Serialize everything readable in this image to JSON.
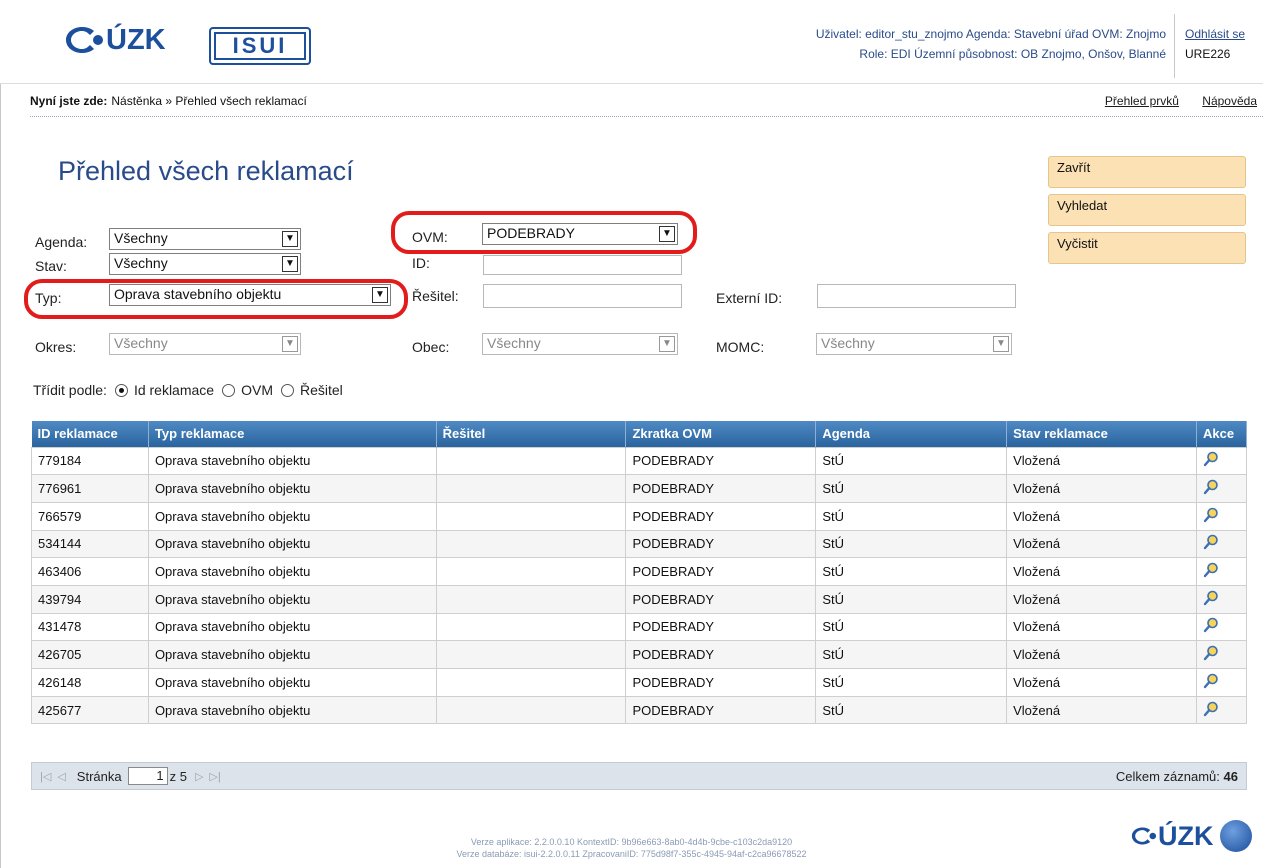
{
  "header": {
    "logo_text": "ÚZK",
    "isui_label": "ISUI",
    "user_line1": "Uživatel: editor_stu_znojmo   Agenda: Stavební úřad   OVM: Znojmo",
    "user_line2": "Role: EDI   Územní působnost: OB Znojmo, Onšov, Blanné",
    "logout_label": "Odhlásit se",
    "code": "URE226"
  },
  "breadcrumb": {
    "prefix": "Nyní jste zde:",
    "path": "Nástěnka » Přehled všech reklamací",
    "link_overview": "Přehled prvků",
    "link_help": "Nápověda"
  },
  "page": {
    "title": "Přehled všech reklamací"
  },
  "actions": {
    "close": "Zavřít",
    "search": "Vyhledat",
    "clear": "Vyčistit"
  },
  "filters": {
    "agenda_label": "Agenda:",
    "agenda_value": "Všechny",
    "stav_label": "Stav:",
    "stav_value": "Všechny",
    "typ_label": "Typ:",
    "typ_value": "Oprava stavebního objektu",
    "okres_label": "Okres:",
    "okres_value": "Všechny",
    "ovm_label": "OVM:",
    "ovm_value": "PODEBRADY",
    "id_label": "ID:",
    "resitel_label": "Řešitel:",
    "obec_label": "Obec:",
    "obec_value": "Všechny",
    "externi_label": "Externí ID:",
    "momc_label": "MOMC:",
    "momc_value": "Všechny"
  },
  "sort": {
    "label": "Třídit podle:",
    "options": [
      "Id reklamace",
      "OVM",
      "Řešitel"
    ],
    "selected": "Id reklamace"
  },
  "table": {
    "columns": [
      "ID reklamace",
      "Typ reklamace",
      "Řešitel",
      "Zkratka OVM",
      "Agenda",
      "Stav reklamace",
      "Akce"
    ],
    "rows": [
      [
        "779184",
        "Oprava stavebního objektu",
        "",
        "PODEBRADY",
        "StÚ",
        "Vložená"
      ],
      [
        "776961",
        "Oprava stavebního objektu",
        "",
        "PODEBRADY",
        "StÚ",
        "Vložená"
      ],
      [
        "766579",
        "Oprava stavebního objektu",
        "",
        "PODEBRADY",
        "StÚ",
        "Vložená"
      ],
      [
        "534144",
        "Oprava stavebního objektu",
        "",
        "PODEBRADY",
        "StÚ",
        "Vložená"
      ],
      [
        "463406",
        "Oprava stavebního objektu",
        "",
        "PODEBRADY",
        "StÚ",
        "Vložená"
      ],
      [
        "439794",
        "Oprava stavebního objektu",
        "",
        "PODEBRADY",
        "StÚ",
        "Vložená"
      ],
      [
        "431478",
        "Oprava stavebního objektu",
        "",
        "PODEBRADY",
        "StÚ",
        "Vložená"
      ],
      [
        "426705",
        "Oprava stavebního objektu",
        "",
        "PODEBRADY",
        "StÚ",
        "Vložená"
      ],
      [
        "426148",
        "Oprava stavebního objektu",
        "",
        "PODEBRADY",
        "StÚ",
        "Vložená"
      ],
      [
        "425677",
        "Oprava stavebního objektu",
        "",
        "PODEBRADY",
        "StÚ",
        "Vložená"
      ]
    ],
    "action_icon": "magnifier-icon"
  },
  "pager": {
    "page_label": "Stránka",
    "page_value": "1",
    "of_label": "z 5",
    "total_label": "Celkem záznamů:",
    "total_value": "46"
  },
  "footer": {
    "line1": "Verze aplikace: 2.2.0.0.10 KontextID: 9b96e663-8ab0-4d4b-9cbe-c103c2da9120",
    "line2": "Verze databáze: isui-2.2.0.0.11 ZpracovaniID: 775d98f7-355c-4945-94af-c2ca96678522",
    "logo_text": "ÚZK"
  },
  "colors": {
    "accent_blue": "#2a4b8a",
    "header_grid": "#2f6fab",
    "action_button": "#fbe1b4",
    "highlight_red": "#e21b1b"
  }
}
